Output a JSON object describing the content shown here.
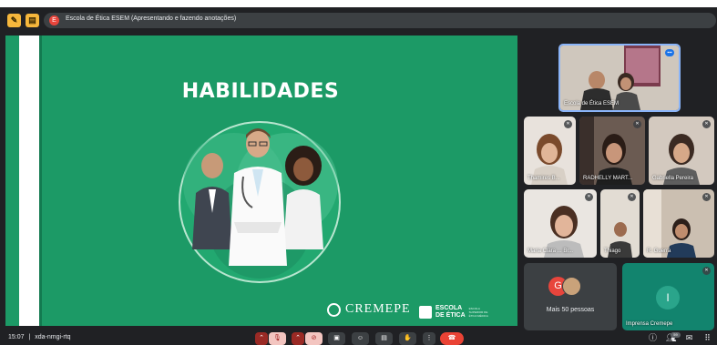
{
  "topbar": {
    "presenter_initial": "E",
    "presenting_text": "Escola de Ética ESEM (Apresentando e fazendo anotações)"
  },
  "slide": {
    "title": "HABILIDADES",
    "logo_cremepe": "CREMEPE",
    "logo_escola_line1": "ESCOLA",
    "logo_escola_line2": "DE ÉTICA",
    "logo_escola_small": "ESCOLA SUPERIOR DE ÉTICA MÉDICA"
  },
  "participants": {
    "main": "Escola de Ética ESEM",
    "p1": "Thamires B...",
    "p2": "RADHELLY MART...",
    "p3": "Gabriella Pereira",
    "p4": "Maria Clara ... Br...",
    "p5": "Thiago",
    "p6": "R. Guerra",
    "more_initial": "G",
    "more_label": "Mais 50 pessoas",
    "imp_initial": "I",
    "imp_label": "Imprensa Cremepe"
  },
  "bottombar": {
    "time": "15:07",
    "separator": "|",
    "meeting_code": "xda-nmgi-rtq",
    "people_count": "59"
  },
  "colors": {
    "slide_green": "#1c9a66",
    "meet_bg": "#202124",
    "hangup_red": "#ea4335",
    "accent_blue": "#8ab4f8"
  },
  "icons": [
    "notes-icon",
    "activities-icon",
    "chevron-up-icon",
    "mic-off-icon",
    "camera-off-icon",
    "present-icon",
    "emoji-icon",
    "captions-icon",
    "raise-hand-icon",
    "more-options-icon",
    "hang-up-icon",
    "info-icon",
    "people-icon",
    "chat-icon",
    "apps-icon"
  ]
}
